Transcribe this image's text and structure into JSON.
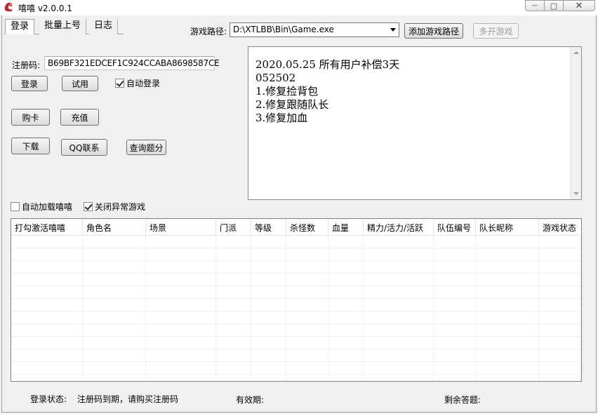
{
  "window": {
    "title": "嘻嘻 v2.0.0.1",
    "controls": {
      "minimize": "—",
      "maximize": "□",
      "close": "✕"
    }
  },
  "tabs": [
    {
      "label": "登录",
      "active": true
    },
    {
      "label": "批量上号",
      "active": false
    },
    {
      "label": "日志",
      "active": false
    }
  ],
  "game_path": {
    "label": "游戏路径:",
    "value": "D:\\XTLBB\\Bin\\Game.exe",
    "add_button": "添加游戏路径",
    "multi_button": "多开游戏"
  },
  "login": {
    "reg_label": "注册码:",
    "reg_code": "B69BF321EDCEF1C924CCABA8698587CE",
    "login_button": "登录",
    "trial_button": "试用",
    "auto_login_label": "自动登录",
    "auto_login_checked": true,
    "buy_card_button": "购卡",
    "recharge_button": "充值",
    "download_button": "下载",
    "qq_button": "QQ联系",
    "query_button": "查询题分"
  },
  "notes": {
    "lines": [
      "2020.05.25 所有用户补偿3天",
      "052502",
      "1.修复捡背包",
      "2.修复跟随队长",
      "3.修复加血"
    ]
  },
  "options": {
    "auto_load_label": "自动加载嘻嘻",
    "auto_load_checked": false,
    "close_abnormal_label": "关闭异常游戏",
    "close_abnormal_checked": true
  },
  "table": {
    "columns": [
      "打勾激活嘻嘻",
      "角色名",
      "场景",
      "门派",
      "等级",
      "杀怪数",
      "血量",
      "精力/活力/活跃",
      "队伍编号",
      "队长昵称",
      "游戏状态"
    ]
  },
  "status": {
    "login_state_label": "登录状态:",
    "login_state_value": "注册码到期，请购买注册码",
    "valid_label": "有效期:",
    "remaining_label": "剩余答题:"
  }
}
